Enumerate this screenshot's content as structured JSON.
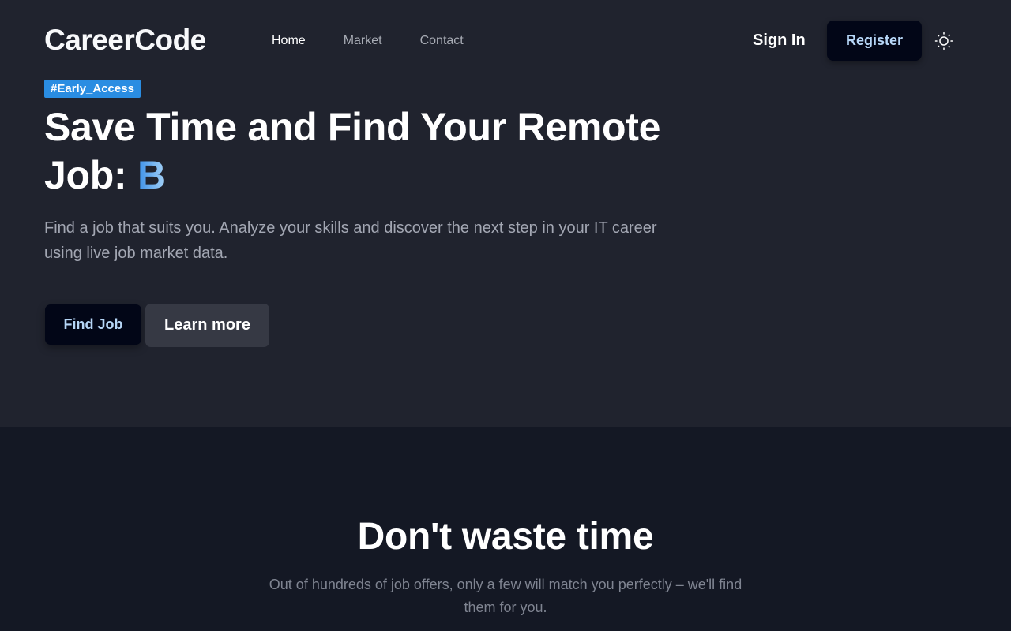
{
  "navbar": {
    "logo": "CareerCode",
    "links": [
      {
        "label": "Home",
        "active": true
      },
      {
        "label": "Market",
        "active": false
      },
      {
        "label": "Contact",
        "active": false
      }
    ],
    "signin_label": "Sign In",
    "register_label": "Register",
    "theme_icon": "sun-icon"
  },
  "hero": {
    "badge": "#Early_Access",
    "headline": "Save Time and Find Your Remote Job: ",
    "rotating_word": "B",
    "subtitle": "Find a job that suits you. Analyze your skills and discover the next step in your IT career using live job market data.",
    "find_job_label": "Find Job",
    "learn_more_label": "Learn more"
  },
  "section2": {
    "title": "Don't waste time",
    "text": "Out of hundreds of job offers, only a few will match you perfectly – we'll find them for you."
  },
  "colors": {
    "hero_bg": "#20232e",
    "section_bg": "#141824",
    "badge_bg": "#2a8de2",
    "primary_button_bg": "#020617",
    "primary_button_text": "#b6d6f7",
    "secondary_button_bg": "#363944"
  }
}
